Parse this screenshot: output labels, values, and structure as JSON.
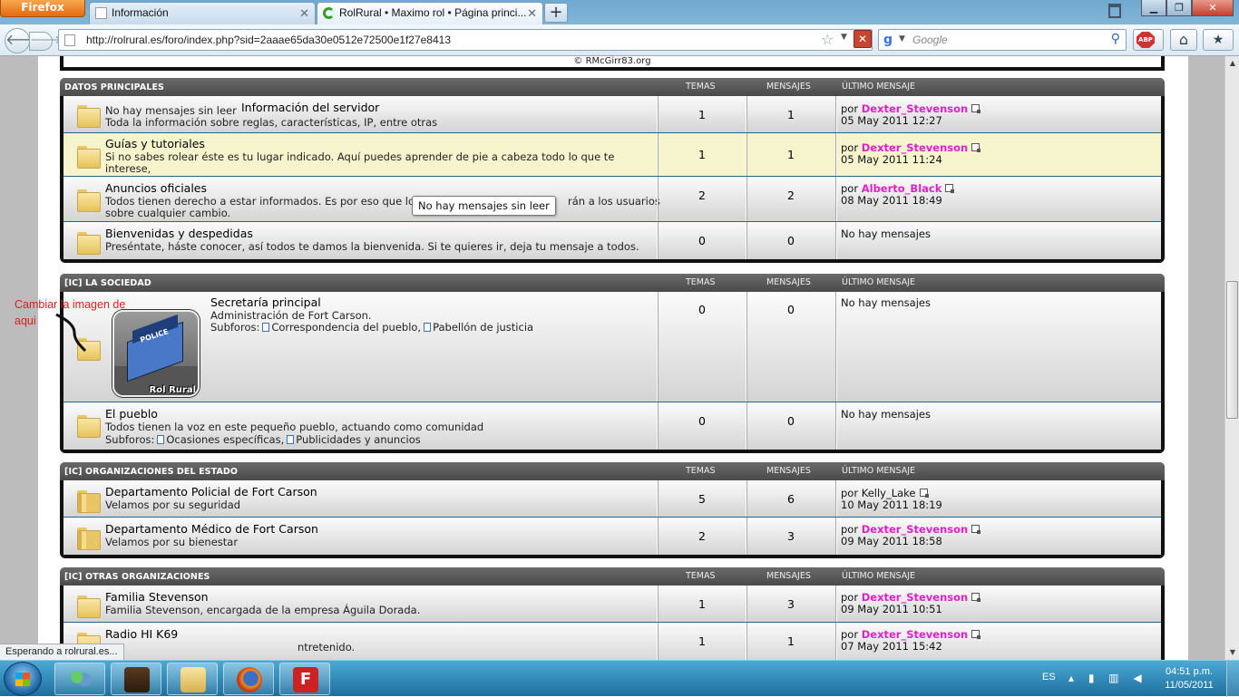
{
  "browser": {
    "app_button": "Firefox",
    "tabs": [
      {
        "label": "Información",
        "active": false
      },
      {
        "label": "RolRural • Maximo rol • Página princi...",
        "active": true
      }
    ],
    "url": "http://rolrural.es/foro/index.php?sid=2aaae65da30e0512e72500e1f27e8413",
    "search_placeholder": "Google",
    "status_text": "Esperando a rolrural.es..."
  },
  "page": {
    "copyright": "© RMcGirr83.org",
    "headers": {
      "temas": "TEMAS",
      "mensajes": "MENSAJES",
      "ultimo": "ÚLTIMO MENSAJE"
    },
    "tooltip": "No hay mensajes sin leer",
    "annotation": "Cambiar la imagen de aqui",
    "image_caption": "Rol Rural",
    "image_sign": "POLICE",
    "categories": [
      {
        "title": "DATOS PRINCIPALES",
        "forums": [
          {
            "prefix": "No hay mensajes sin leer",
            "name": "Información del servidor",
            "desc": "Toda la información sobre reglas, características, IP, entre otras",
            "temas": "1",
            "mensajes": "1",
            "por": "por",
            "user": "Dexter_Stevenson",
            "date": "05 May 2011 12:27"
          },
          {
            "name": "Guías y tutoriales",
            "desc": "Si no sabes rolear éste es tu lugar indicado. Aquí puedes aprender de pie a cabeza todo lo que te interese,",
            "temas": "1",
            "mensajes": "1",
            "por": "por",
            "user": "Dexter_Stevenson",
            "date": "05 May 2011 11:24"
          },
          {
            "name": "Anuncios oficiales",
            "desc": "Todos tienen derecho a estar informados. Es por eso que lo",
            "desc2": "rán a los usuarios",
            "desc3": "sobre cualquier cambio.",
            "temas": "2",
            "mensajes": "2",
            "por": "por",
            "user": "Alberto_Black",
            "date": "08 May 2011 18:49"
          },
          {
            "name": "Bienvenidas y despedidas",
            "desc": "Preséntate, háste conocer, así todos te damos la bienvenida. Si te quieres ir, deja tu mensaje a todos.",
            "temas": "0",
            "mensajes": "0",
            "no_posts": "No hay mensajes"
          }
        ]
      },
      {
        "title": "[IC] LA SOCIEDAD",
        "forums": [
          {
            "name": "Secretaría principal",
            "desc": "Administración de Fort Carson.",
            "sub_label": "Subforos:",
            "sub1": "Correspondencia del pueblo,",
            "sub2": "Pabellón de justicia",
            "temas": "0",
            "mensajes": "0",
            "no_posts": "No hay mensajes"
          },
          {
            "name": "El pueblo",
            "desc": "Todos tienen la voz en este pequeño pueblo, actuando como comunidad",
            "sub_label": "Subforos:",
            "sub1": "Ocasiones específicas,",
            "sub2": "Publicidades y anuncios",
            "temas": "0",
            "mensajes": "0",
            "no_posts": "No hay mensajes"
          }
        ]
      },
      {
        "title": "[IC] ORGANIZACIONES DEL ESTADO",
        "forums": [
          {
            "name": "Departamento Policial de Fort Carson",
            "desc": "Velamos por su seguridad",
            "temas": "5",
            "mensajes": "6",
            "por": "por",
            "user": "Kelly_Lake",
            "date": "10 May 2011 18:19"
          },
          {
            "name": "Departamento Médico de Fort Carson",
            "desc": "Velamos por su bienestar",
            "temas": "2",
            "mensajes": "3",
            "por": "por",
            "user": "Dexter_Stevenson",
            "date": "09 May 2011 18:58"
          }
        ]
      },
      {
        "title": "[IC] OTRAS ORGANIZACIONES",
        "forums": [
          {
            "name": "Familia Stevenson",
            "desc": "Familia Stevenson, encargada de la empresa Águila Dorada.",
            "temas": "1",
            "mensajes": "3",
            "por": "por",
            "user": "Dexter_Stevenson",
            "date": "09 May 2011 10:51"
          },
          {
            "name": "Radio HI K69",
            "desc": "ntretenido.",
            "temas": "1",
            "mensajes": "1",
            "por": "por",
            "user": "Dexter_Stevenson",
            "date": "07 May 2011 15:42"
          }
        ]
      }
    ]
  },
  "taskbar": {
    "lang": "ES",
    "time": "04:51 p.m.",
    "date": "11/05/2011"
  }
}
